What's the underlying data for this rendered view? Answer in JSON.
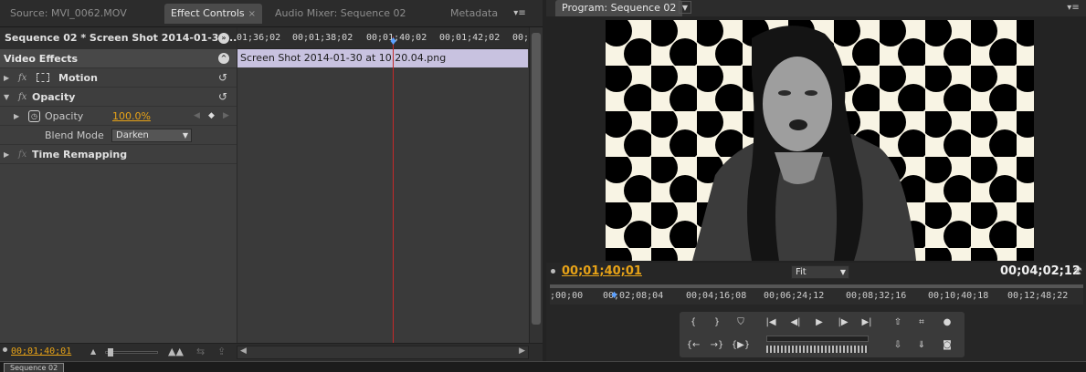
{
  "left_panel": {
    "tabs": [
      {
        "label": "Source: MVI_0062.MOV",
        "active": false
      },
      {
        "label": "Effect Controls",
        "active": true
      },
      {
        "label": "Audio Mixer: Sequence 02",
        "active": false
      },
      {
        "label": "Metadata",
        "active": false
      }
    ],
    "tab_close_glyph": "×",
    "sequence_header": "Sequence 02 * Screen Shot 2014-01-30 ...",
    "video_effects_label": "Video Effects",
    "effects": {
      "motion": "Motion",
      "opacity": "Opacity",
      "opacity_prop": "Opacity",
      "opacity_value": "100.0",
      "opacity_unit": "%",
      "blend_mode_label": "Blend Mode",
      "blend_mode_value": "Darken",
      "time_remapping": "Time Remapping"
    },
    "ruler_labels": [
      "01;36;02",
      "00;01;38;02",
      "00;01;40;02",
      "00;01;42;02",
      "00;"
    ],
    "clip_name": "Screen Shot 2014-01-30 at 10.20.04.png",
    "footer_timecode": "00;01;40;01"
  },
  "program_monitor": {
    "tab_label": "Program: Sequence 02",
    "current_timecode": "00;01;40;01",
    "fit_label": "Fit",
    "duration": "00;04;02;12",
    "ruler_labels": [
      ";00;00",
      "00;02;08;04",
      "00;04;16;08",
      "00;06;24;12",
      "00;08;32;16",
      "00;10;40;18",
      "00;12;48;22"
    ]
  },
  "bottom_tab_label": "Sequence 02",
  "colors": {
    "accent_timecode": "#e8a317",
    "clip_bar": "#c8c2e0",
    "playhead": "#c42a2a",
    "dot_pattern": "#000000",
    "video_background": "#f8f4e4"
  },
  "icons": [
    "menu-icon",
    "reset-icon",
    "stopwatch-icon",
    "keyframe-nav-icon",
    "zoom-mountain-icon",
    "play-icon",
    "step-back-icon",
    "step-forward-icon",
    "mark-in-icon",
    "mark-out-icon",
    "lift-icon",
    "extract-icon",
    "export-frame-icon",
    "safe-margins-icon"
  ]
}
